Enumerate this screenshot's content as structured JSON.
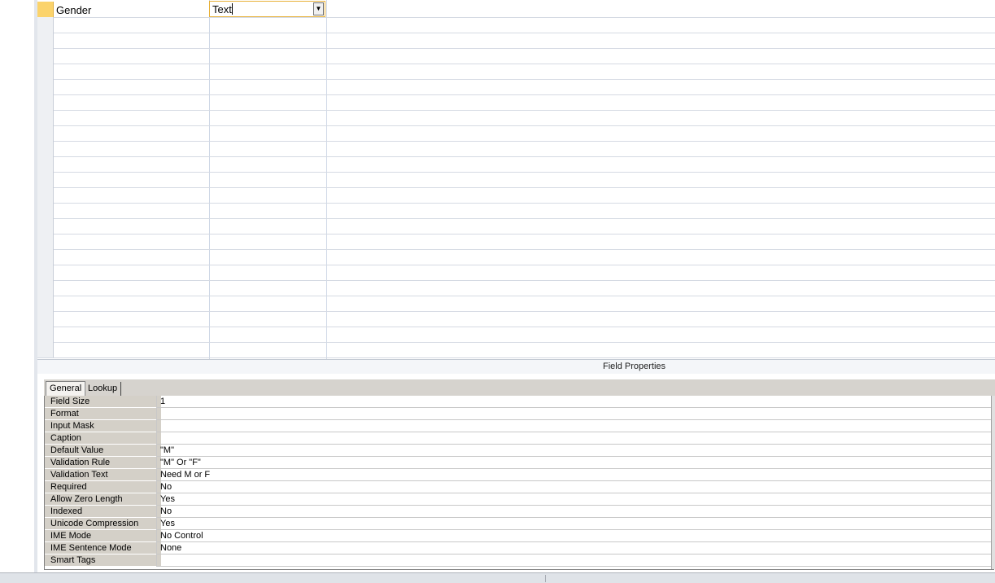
{
  "grid": {
    "current_row": {
      "field_name": "Gender",
      "data_type": "Text"
    },
    "empty_row_count": 22
  },
  "field_properties": {
    "title": "Field Properties",
    "tabs": [
      {
        "label": "General",
        "active": true
      },
      {
        "label": "Lookup",
        "active": false
      }
    ],
    "rows": [
      {
        "label": "Field Size",
        "value": "1"
      },
      {
        "label": "Format",
        "value": ""
      },
      {
        "label": "Input Mask",
        "value": ""
      },
      {
        "label": "Caption",
        "value": ""
      },
      {
        "label": "Default Value",
        "value": "\"M\""
      },
      {
        "label": "Validation Rule",
        "value": "\"M\" Or \"F\""
      },
      {
        "label": "Validation Text",
        "value": "Need M or F"
      },
      {
        "label": "Required",
        "value": "No"
      },
      {
        "label": "Allow Zero Length",
        "value": "Yes"
      },
      {
        "label": "Indexed",
        "value": "No"
      },
      {
        "label": "Unicode Compression",
        "value": "Yes"
      },
      {
        "label": "IME Mode",
        "value": "No Control"
      },
      {
        "label": "IME Sentence Mode",
        "value": "None"
      },
      {
        "label": "Smart Tags",
        "value": ""
      }
    ]
  },
  "colors": {
    "current_row_selector": "#fbd36b",
    "focus_border": "#e8b23a",
    "property_label_bg": "#d4d0c8"
  }
}
